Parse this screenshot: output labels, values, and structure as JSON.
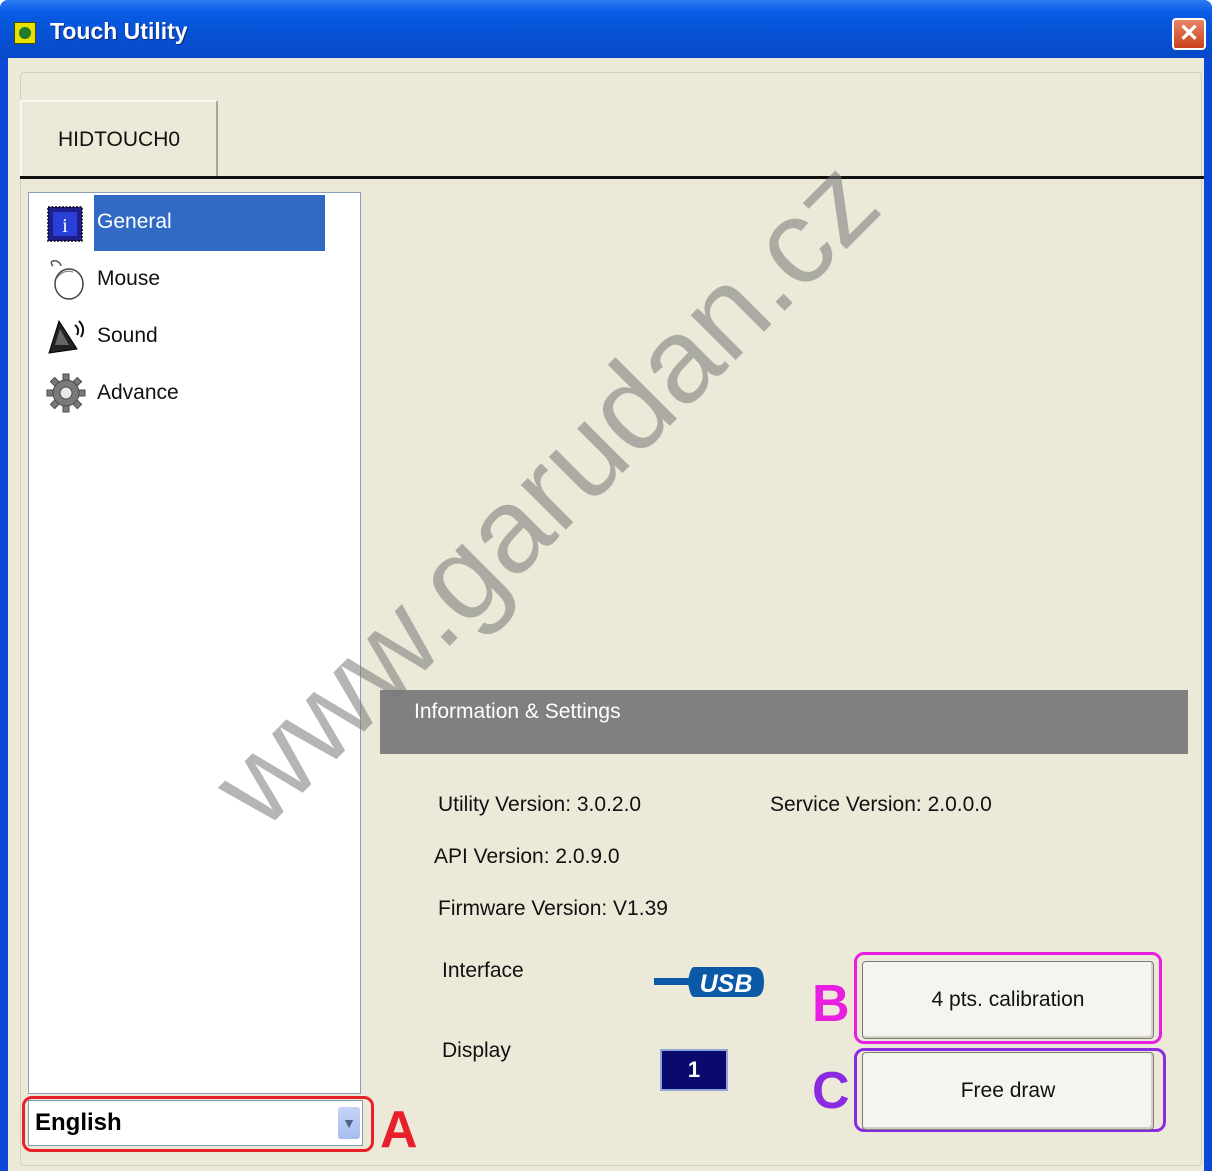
{
  "window": {
    "title": "Touch Utility",
    "close_symbol": "✕"
  },
  "tabs": [
    {
      "label": "HIDTOUCH0"
    }
  ],
  "sidebar": {
    "items": [
      {
        "label": "General",
        "icon": "info-icon"
      },
      {
        "label": "Mouse",
        "icon": "mouse-icon"
      },
      {
        "label": "Sound",
        "icon": "speaker-icon"
      },
      {
        "label": "Advance",
        "icon": "gear-icon"
      }
    ],
    "selected": "General"
  },
  "language": {
    "value": "English"
  },
  "info_section": {
    "header": "Information & Settings",
    "utility_version": "Utility Version: 3.0.2.0",
    "service_version": "Service Version: 2.0.0.0",
    "api_version": "API Version: 2.0.9.0",
    "firmware_version": "Firmware Version: V1.39",
    "interface_label": "Interface",
    "interface_logo_text": "USB",
    "display_label": "Display",
    "display_value": "1"
  },
  "buttons": {
    "calibration": "4 pts. calibration",
    "free_draw": "Free draw"
  },
  "annotations": {
    "a": {
      "letter": "A",
      "color": "#e8202a"
    },
    "b": {
      "letter": "B",
      "color": "#e81ee0"
    },
    "c": {
      "letter": "C",
      "color": "#8a2be2"
    }
  },
  "watermark": "www.garudan.cz",
  "colors": {
    "titlebar": "#0553d6",
    "client_bg": "#ece9d8",
    "selection": "#316ac5",
    "section_header": "#808080"
  }
}
